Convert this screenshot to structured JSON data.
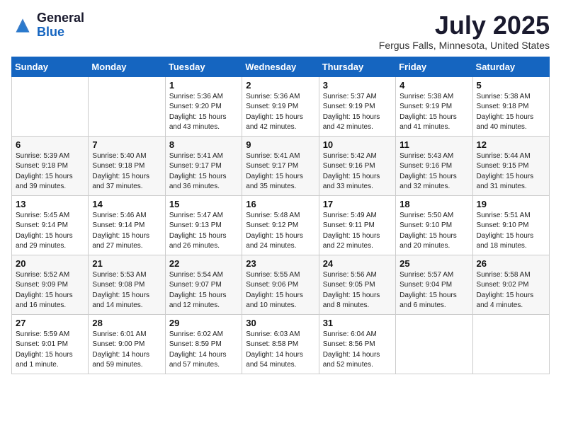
{
  "header": {
    "logo_general": "General",
    "logo_blue": "Blue",
    "month": "July 2025",
    "location": "Fergus Falls, Minnesota, United States"
  },
  "days_of_week": [
    "Sunday",
    "Monday",
    "Tuesday",
    "Wednesday",
    "Thursday",
    "Friday",
    "Saturday"
  ],
  "weeks": [
    [
      {
        "day": "",
        "info": ""
      },
      {
        "day": "",
        "info": ""
      },
      {
        "day": "1",
        "info": "Sunrise: 5:36 AM\nSunset: 9:20 PM\nDaylight: 15 hours\nand 43 minutes."
      },
      {
        "day": "2",
        "info": "Sunrise: 5:36 AM\nSunset: 9:19 PM\nDaylight: 15 hours\nand 42 minutes."
      },
      {
        "day": "3",
        "info": "Sunrise: 5:37 AM\nSunset: 9:19 PM\nDaylight: 15 hours\nand 42 minutes."
      },
      {
        "day": "4",
        "info": "Sunrise: 5:38 AM\nSunset: 9:19 PM\nDaylight: 15 hours\nand 41 minutes."
      },
      {
        "day": "5",
        "info": "Sunrise: 5:38 AM\nSunset: 9:18 PM\nDaylight: 15 hours\nand 40 minutes."
      }
    ],
    [
      {
        "day": "6",
        "info": "Sunrise: 5:39 AM\nSunset: 9:18 PM\nDaylight: 15 hours\nand 39 minutes."
      },
      {
        "day": "7",
        "info": "Sunrise: 5:40 AM\nSunset: 9:18 PM\nDaylight: 15 hours\nand 37 minutes."
      },
      {
        "day": "8",
        "info": "Sunrise: 5:41 AM\nSunset: 9:17 PM\nDaylight: 15 hours\nand 36 minutes."
      },
      {
        "day": "9",
        "info": "Sunrise: 5:41 AM\nSunset: 9:17 PM\nDaylight: 15 hours\nand 35 minutes."
      },
      {
        "day": "10",
        "info": "Sunrise: 5:42 AM\nSunset: 9:16 PM\nDaylight: 15 hours\nand 33 minutes."
      },
      {
        "day": "11",
        "info": "Sunrise: 5:43 AM\nSunset: 9:16 PM\nDaylight: 15 hours\nand 32 minutes."
      },
      {
        "day": "12",
        "info": "Sunrise: 5:44 AM\nSunset: 9:15 PM\nDaylight: 15 hours\nand 31 minutes."
      }
    ],
    [
      {
        "day": "13",
        "info": "Sunrise: 5:45 AM\nSunset: 9:14 PM\nDaylight: 15 hours\nand 29 minutes."
      },
      {
        "day": "14",
        "info": "Sunrise: 5:46 AM\nSunset: 9:14 PM\nDaylight: 15 hours\nand 27 minutes."
      },
      {
        "day": "15",
        "info": "Sunrise: 5:47 AM\nSunset: 9:13 PM\nDaylight: 15 hours\nand 26 minutes."
      },
      {
        "day": "16",
        "info": "Sunrise: 5:48 AM\nSunset: 9:12 PM\nDaylight: 15 hours\nand 24 minutes."
      },
      {
        "day": "17",
        "info": "Sunrise: 5:49 AM\nSunset: 9:11 PM\nDaylight: 15 hours\nand 22 minutes."
      },
      {
        "day": "18",
        "info": "Sunrise: 5:50 AM\nSunset: 9:10 PM\nDaylight: 15 hours\nand 20 minutes."
      },
      {
        "day": "19",
        "info": "Sunrise: 5:51 AM\nSunset: 9:10 PM\nDaylight: 15 hours\nand 18 minutes."
      }
    ],
    [
      {
        "day": "20",
        "info": "Sunrise: 5:52 AM\nSunset: 9:09 PM\nDaylight: 15 hours\nand 16 minutes."
      },
      {
        "day": "21",
        "info": "Sunrise: 5:53 AM\nSunset: 9:08 PM\nDaylight: 15 hours\nand 14 minutes."
      },
      {
        "day": "22",
        "info": "Sunrise: 5:54 AM\nSunset: 9:07 PM\nDaylight: 15 hours\nand 12 minutes."
      },
      {
        "day": "23",
        "info": "Sunrise: 5:55 AM\nSunset: 9:06 PM\nDaylight: 15 hours\nand 10 minutes."
      },
      {
        "day": "24",
        "info": "Sunrise: 5:56 AM\nSunset: 9:05 PM\nDaylight: 15 hours\nand 8 minutes."
      },
      {
        "day": "25",
        "info": "Sunrise: 5:57 AM\nSunset: 9:04 PM\nDaylight: 15 hours\nand 6 minutes."
      },
      {
        "day": "26",
        "info": "Sunrise: 5:58 AM\nSunset: 9:02 PM\nDaylight: 15 hours\nand 4 minutes."
      }
    ],
    [
      {
        "day": "27",
        "info": "Sunrise: 5:59 AM\nSunset: 9:01 PM\nDaylight: 15 hours\nand 1 minute."
      },
      {
        "day": "28",
        "info": "Sunrise: 6:01 AM\nSunset: 9:00 PM\nDaylight: 14 hours\nand 59 minutes."
      },
      {
        "day": "29",
        "info": "Sunrise: 6:02 AM\nSunset: 8:59 PM\nDaylight: 14 hours\nand 57 minutes."
      },
      {
        "day": "30",
        "info": "Sunrise: 6:03 AM\nSunset: 8:58 PM\nDaylight: 14 hours\nand 54 minutes."
      },
      {
        "day": "31",
        "info": "Sunrise: 6:04 AM\nSunset: 8:56 PM\nDaylight: 14 hours\nand 52 minutes."
      },
      {
        "day": "",
        "info": ""
      },
      {
        "day": "",
        "info": ""
      }
    ]
  ]
}
